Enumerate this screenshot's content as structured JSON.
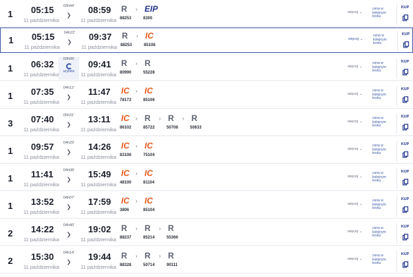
{
  "colors": {
    "accent": "#3d5aa8",
    "ic": "#e8591c",
    "eip": "#23358f",
    "regional": "#5d6370"
  },
  "more_label": "więcej",
  "price_label": "cena w kolejnym kroku",
  "buy_label": "KUP",
  "rows": [
    {
      "changes": "1",
      "dep_time": "05:15",
      "dep_date": "11 października",
      "duration": "03h44'",
      "arr_time": "08:59",
      "arr_date": "11 października",
      "fast": false,
      "trains": [
        {
          "cat": "R",
          "num": "88253"
        },
        {
          "cat": "EIP",
          "num": "8300"
        }
      ]
    },
    {
      "changes": "1",
      "dep_time": "05:15",
      "dep_date": "11 października",
      "duration": "04h22'",
      "arr_time": "09:37",
      "arr_date": "11 października",
      "fast": false,
      "selected": true,
      "trains": [
        {
          "cat": "R",
          "num": "88253"
        },
        {
          "cat": "IC",
          "num": "85108"
        }
      ]
    },
    {
      "changes": "1",
      "dep_time": "06:32",
      "dep_date": "11 października",
      "duration": "03h09'",
      "arr_time": "09:41",
      "arr_date": "11 października",
      "fast": true,
      "fast_label": "szybkie",
      "trains": [
        {
          "cat": "R",
          "num": "80990"
        },
        {
          "cat": "R",
          "num": "55228"
        }
      ]
    },
    {
      "changes": "1",
      "dep_time": "07:35",
      "dep_date": "11 października",
      "duration": "04h12'",
      "arr_time": "11:47",
      "arr_date": "11 października",
      "fast": false,
      "trains": [
        {
          "cat": "IC",
          "num": "78173"
        },
        {
          "cat": "IC",
          "num": "85106"
        }
      ]
    },
    {
      "changes": "3",
      "dep_time": "07:40",
      "dep_date": "11 października",
      "duration": "05h31'",
      "arr_time": "13:11",
      "arr_date": "11 października",
      "fast": false,
      "trains": [
        {
          "cat": "IC",
          "num": "86102"
        },
        {
          "cat": "R",
          "num": "85722"
        },
        {
          "cat": "R",
          "num": "50708"
        },
        {
          "cat": "R",
          "num": "50633"
        }
      ]
    },
    {
      "changes": "1",
      "dep_time": "09:57",
      "dep_date": "11 października",
      "duration": "04h29'",
      "arr_time": "14:26",
      "arr_date": "11 października",
      "fast": false,
      "trains": [
        {
          "cat": "IC",
          "num": "83106"
        },
        {
          "cat": "IC",
          "num": "75104"
        }
      ]
    },
    {
      "changes": "1",
      "dep_time": "11:41",
      "dep_date": "11 października",
      "duration": "04h08'",
      "arr_time": "15:49",
      "arr_date": "11 października",
      "fast": false,
      "trains": [
        {
          "cat": "IC",
          "num": "48100"
        },
        {
          "cat": "IC",
          "num": "81104"
        }
      ]
    },
    {
      "changes": "1",
      "dep_time": "13:52",
      "dep_date": "11 października",
      "duration": "04h07'",
      "arr_time": "17:59",
      "arr_date": "11 października",
      "fast": false,
      "trains": [
        {
          "cat": "IC",
          "num": "3806"
        },
        {
          "cat": "IC",
          "num": "85104"
        }
      ]
    },
    {
      "changes": "2",
      "dep_time": "14:22",
      "dep_date": "11 października",
      "duration": "04h40'",
      "arr_time": "19:02",
      "arr_date": "11 października",
      "fast": false,
      "trains": [
        {
          "cat": "R",
          "num": "88237"
        },
        {
          "cat": "R",
          "num": "85214"
        },
        {
          "cat": "R",
          "num": "55366"
        }
      ]
    },
    {
      "changes": "2",
      "dep_time": "15:30",
      "dep_date": "11 października",
      "duration": "04h14'",
      "arr_time": "19:44",
      "arr_date": "11 października",
      "fast": false,
      "trains": [
        {
          "cat": "R",
          "num": "88328"
        },
        {
          "cat": "R",
          "num": "50714"
        },
        {
          "cat": "R",
          "num": "90111"
        }
      ]
    }
  ]
}
